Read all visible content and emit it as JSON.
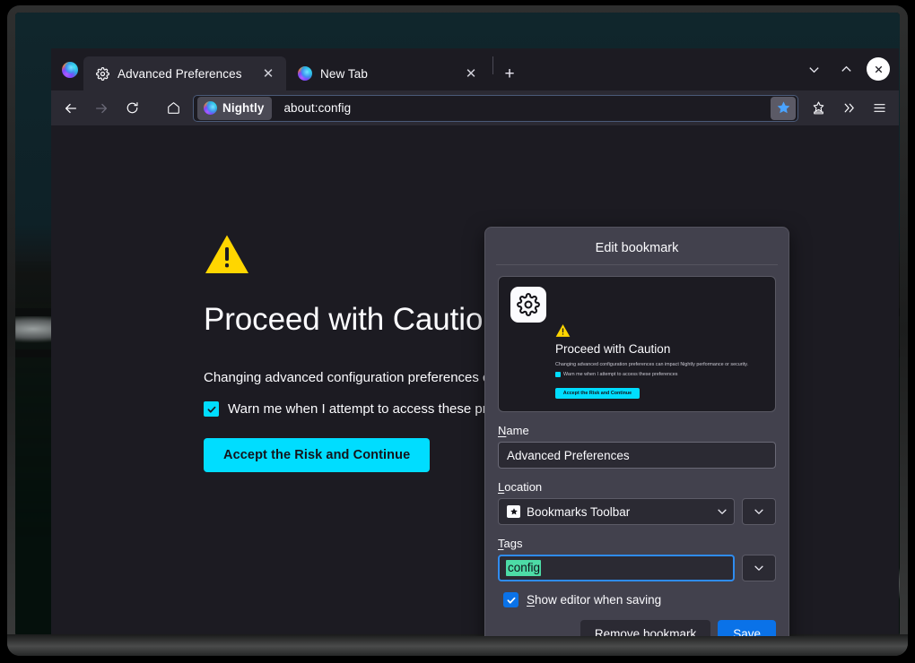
{
  "window": {
    "controls": {
      "minimize": "minimize-chevron-down",
      "maximize": "maximize-chevron-up",
      "close": "close-x"
    }
  },
  "tabs": [
    {
      "title": "Advanced Preferences",
      "favicon": "gear-icon",
      "active": true,
      "close_label": "✕"
    },
    {
      "title": "New Tab",
      "favicon": "firefox-icon",
      "active": false,
      "close_label": "✕"
    }
  ],
  "newtab_label": "+",
  "toolbar": {
    "back": "back-arrow",
    "forward": "forward-arrow",
    "reload": "reload-icon",
    "home": "home-icon",
    "identity_label": "Nightly",
    "url": "about:config",
    "bookmark_star": "star-icon",
    "save_to_pocket": "pocket-icon",
    "overflow": "»",
    "app_menu": "hamburger-icon"
  },
  "page": {
    "heading": "Proceed with Caution",
    "description": "Changing advanced configuration preferences can impact Nightly performance or security.",
    "checkbox_label": "Warn me when I attempt to access these preferences",
    "checkbox_checked": true,
    "accept_button": "Accept the Risk and Continue"
  },
  "bookmark_panel": {
    "title": "Edit bookmark",
    "thumbnail": {
      "favicon": "gear-icon",
      "warning_icon": "warning-triangle",
      "heading": "Proceed with Caution",
      "description": "Changing advanced configuration preferences can impact Nightly performance or security.",
      "checkbox_label": "Warn me when I attempt to access these preferences",
      "button": "Accept the Risk and Continue"
    },
    "name_label_pre": "N",
    "name_label_rest": "ame",
    "name_value": "Advanced Preferences",
    "location_label_pre": "L",
    "location_label_rest": "ocation",
    "location_value": "Bookmarks Toolbar",
    "location_icon": "bookmarks-toolbar-star-icon",
    "tags_label_pre": "T",
    "tags_label_rest": "ags",
    "tags_value": "config",
    "tags_selected": true,
    "show_editor_pre": "S",
    "show_editor_rest": "how editor when saving",
    "show_editor_checked": true,
    "remove_button_pre": "R",
    "remove_button_rest": "emove bookmark",
    "save_button": "Save"
  },
  "colors": {
    "accent_blue": "#0a72e8",
    "page_cyan": "#00ddff",
    "warning_yellow": "#ffd600",
    "panel_bg": "#42414d",
    "chrome_bg": "#2b2a33",
    "content_bg": "#1c1b22",
    "tag_selection": "#4ddba6",
    "focus_ring": "#2f8cf0"
  }
}
